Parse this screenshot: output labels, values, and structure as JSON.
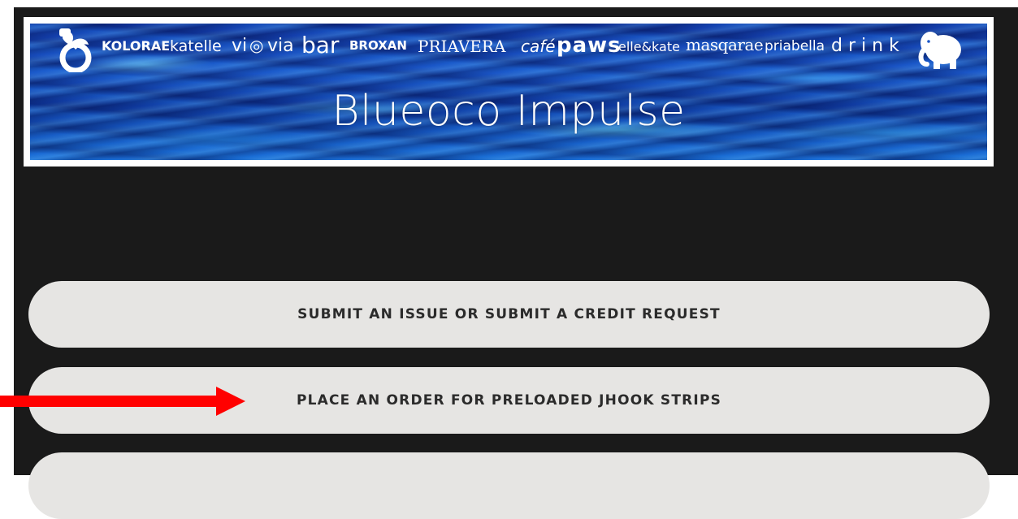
{
  "banner": {
    "title": "Blueoco Impulse",
    "brands": [
      "KOLORAE",
      "katelle",
      "vi",
      "via",
      "bar",
      "BROXAN",
      "PRIAVERA",
      "café",
      "paws",
      "elle&kate",
      "masqarae",
      "priabella",
      "drink"
    ]
  },
  "menu": {
    "items": [
      {
        "label": "SUBMIT AN ISSUE OR SUBMIT A CREDIT REQUEST"
      },
      {
        "label": "PLACE AN ORDER FOR PRELOADED JHOOK STRIPS"
      },
      {
        "label": ""
      }
    ]
  },
  "colors": {
    "page_background": "#1a1a1a",
    "button_background": "#e6e5e3",
    "button_text": "#2b2b2b",
    "arrow": "#ff0000",
    "banner_water": "#1a56c8"
  },
  "annotation": {
    "icon": "right-arrow-icon",
    "points_to": "PLACE AN ORDER FOR PRELOADED JHOOK STRIPS"
  }
}
